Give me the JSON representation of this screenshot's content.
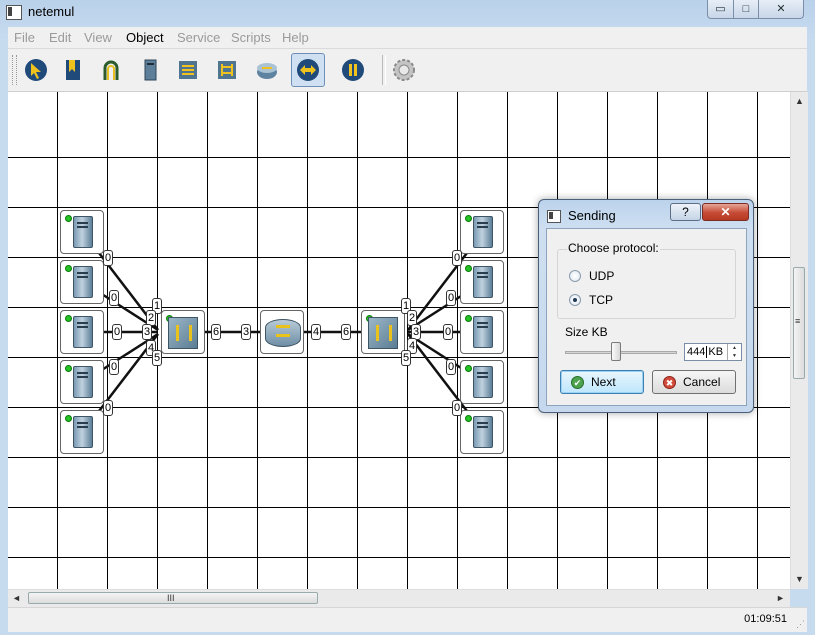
{
  "window": {
    "title": "netemul",
    "min_glyph": "▭",
    "max_glyph": "□",
    "close_glyph": "✕"
  },
  "menu": [
    "File",
    "Edit",
    "View",
    "Object",
    "Service",
    "Scripts",
    "Help"
  ],
  "menu_active": "Object",
  "toolbar": {
    "tools": [
      {
        "name": "move-tool-icon"
      },
      {
        "name": "note-tool-icon"
      },
      {
        "name": "cable-tool-icon"
      },
      {
        "name": "computer-tool-icon"
      },
      {
        "name": "hub-tool-icon"
      },
      {
        "name": "switch-tool-icon"
      },
      {
        "name": "router-tool-icon"
      },
      {
        "name": "send-tool-icon",
        "active": true
      },
      {
        "name": "pause-tool-icon"
      },
      {
        "name": "settings-gear-icon"
      }
    ]
  },
  "ports": {
    "left_pcs": [
      "0",
      "0",
      "0",
      "0",
      "0"
    ],
    "left_switch": [
      "1",
      "2",
      "3",
      "4",
      "5",
      "6"
    ],
    "router": [
      "3",
      "4"
    ],
    "right_switch": [
      "6",
      "1",
      "2",
      "3",
      "4",
      "5"
    ],
    "right_pcs": [
      "0",
      "0",
      "0",
      "0",
      "0"
    ]
  },
  "dialog": {
    "title": "Sending",
    "help": "?",
    "close": "✕",
    "group_title": "Choose protocol:",
    "protocols": [
      {
        "label": "UDP",
        "checked": false
      },
      {
        "label": "TCP",
        "checked": true
      }
    ],
    "size_label": "Size KB",
    "size_value": "444",
    "size_unit": "KB",
    "slider_fraction": 0.45,
    "next_label": "Next",
    "cancel_label": "Cancel",
    "next_glyph": "✔",
    "cancel_glyph": "✖"
  },
  "scroll": {
    "h_grip": "III",
    "v_grip": "≡",
    "up": "▲",
    "down": "▼",
    "left": "◄",
    "right": "►"
  },
  "status": {
    "time": "01:09:51"
  },
  "colors": {
    "grid_line": "#000000",
    "led_on": "#22c322",
    "accent": "#3c7fb1"
  }
}
